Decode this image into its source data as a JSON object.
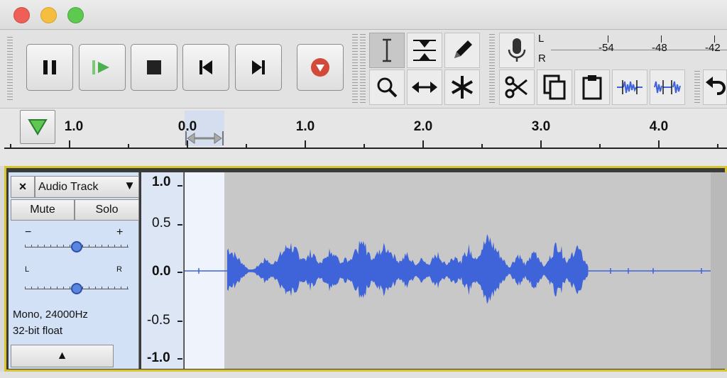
{
  "window": {
    "title": ""
  },
  "transport": {
    "pause": "pause",
    "play": "play",
    "stop": "stop",
    "skip_start": "skip-to-start",
    "skip_end": "skip-to-end",
    "record": "record"
  },
  "meter": {
    "left_label": "L",
    "right_label": "R",
    "ticks": [
      "-54",
      "-48",
      "-42"
    ]
  },
  "timeline": {
    "labels": [
      "1.0",
      "0.0",
      "1.0",
      "2.0",
      "3.0",
      "4.0"
    ]
  },
  "track": {
    "name": "Audio Track",
    "close_label": "×",
    "mute_label": "Mute",
    "solo_label": "Solo",
    "gain_minus": "−",
    "gain_plus": "+",
    "pan_left": "L",
    "pan_right": "R",
    "gain_value": 0.5,
    "pan_value": 0.5,
    "format_line1": "Mono, 24000Hz",
    "format_line2": "32-bit float",
    "collapse_label": "▲",
    "dropdown_label": "▼"
  },
  "vruler": {
    "labels": [
      "1.0",
      "0.5",
      "0.0",
      "-0.5",
      "-1.0"
    ]
  },
  "colors": {
    "waveform": "#3f63d8",
    "track_border": "#d8c530",
    "record": "#d24a3a",
    "play": "#4caf50"
  }
}
